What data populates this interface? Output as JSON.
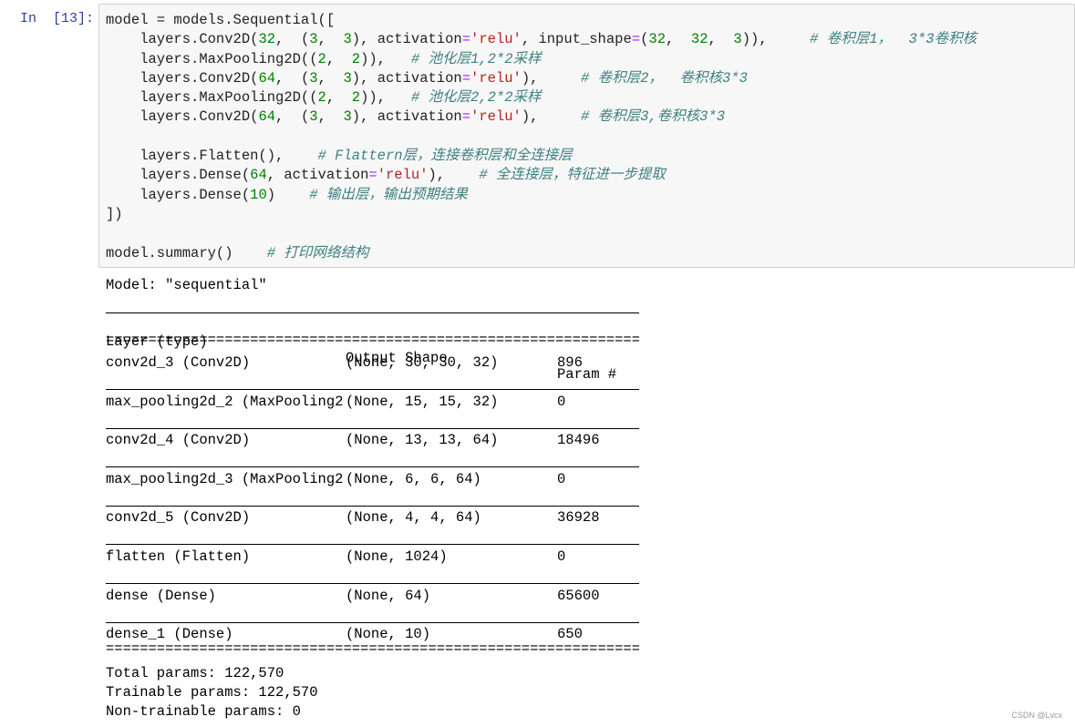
{
  "cell": {
    "prompt": "In  [13]:"
  },
  "code_lines": [
    [
      {
        "t": "model = models.Sequential([",
        "c": ""
      }
    ],
    [
      {
        "t": "    layers.Conv2D(",
        "c": ""
      },
      {
        "t": "32",
        "c": "n"
      },
      {
        "t": ",  (",
        "c": ""
      },
      {
        "t": "3",
        "c": "n"
      },
      {
        "t": ",  ",
        "c": ""
      },
      {
        "t": "3",
        "c": "n"
      },
      {
        "t": "), activation",
        "c": ""
      },
      {
        "t": "=",
        "c": "o"
      },
      {
        "t": "'relu'",
        "c": "s"
      },
      {
        "t": ", input_shape",
        "c": ""
      },
      {
        "t": "=",
        "c": "o"
      },
      {
        "t": "(",
        "c": ""
      },
      {
        "t": "32",
        "c": "n"
      },
      {
        "t": ",  ",
        "c": ""
      },
      {
        "t": "32",
        "c": "n"
      },
      {
        "t": ",  ",
        "c": ""
      },
      {
        "t": "3",
        "c": "n"
      },
      {
        "t": ")),     ",
        "c": ""
      },
      {
        "t": "# 卷积层1，  3*3卷积核",
        "c": "c"
      }
    ],
    [
      {
        "t": "    layers.MaxPooling2D((",
        "c": ""
      },
      {
        "t": "2",
        "c": "n"
      },
      {
        "t": ",  ",
        "c": ""
      },
      {
        "t": "2",
        "c": "n"
      },
      {
        "t": ")),   ",
        "c": ""
      },
      {
        "t": "# 池化层1,2*2采样",
        "c": "c"
      }
    ],
    [
      {
        "t": "    layers.Conv2D(",
        "c": ""
      },
      {
        "t": "64",
        "c": "n"
      },
      {
        "t": ",  (",
        "c": ""
      },
      {
        "t": "3",
        "c": "n"
      },
      {
        "t": ",  ",
        "c": ""
      },
      {
        "t": "3",
        "c": "n"
      },
      {
        "t": "), activation",
        "c": ""
      },
      {
        "t": "=",
        "c": "o"
      },
      {
        "t": "'relu'",
        "c": "s"
      },
      {
        "t": "),     ",
        "c": ""
      },
      {
        "t": "# 卷积层2，  卷积核3*3",
        "c": "c"
      }
    ],
    [
      {
        "t": "    layers.MaxPooling2D((",
        "c": ""
      },
      {
        "t": "2",
        "c": "n"
      },
      {
        "t": ",  ",
        "c": ""
      },
      {
        "t": "2",
        "c": "n"
      },
      {
        "t": ")),   ",
        "c": ""
      },
      {
        "t": "# 池化层2,2*2采样",
        "c": "c"
      }
    ],
    [
      {
        "t": "    layers.Conv2D(",
        "c": ""
      },
      {
        "t": "64",
        "c": "n"
      },
      {
        "t": ",  (",
        "c": ""
      },
      {
        "t": "3",
        "c": "n"
      },
      {
        "t": ",  ",
        "c": ""
      },
      {
        "t": "3",
        "c": "n"
      },
      {
        "t": "), activation",
        "c": ""
      },
      {
        "t": "=",
        "c": "o"
      },
      {
        "t": "'relu'",
        "c": "s"
      },
      {
        "t": "),     ",
        "c": ""
      },
      {
        "t": "# 卷积层3,卷积核3*3",
        "c": "c"
      }
    ],
    [
      {
        "t": "",
        "c": ""
      }
    ],
    [
      {
        "t": "    layers.Flatten(),    ",
        "c": ""
      },
      {
        "t": "# Flattern层，连接卷积层和全连接层",
        "c": "c"
      }
    ],
    [
      {
        "t": "    layers.Dense(",
        "c": ""
      },
      {
        "t": "64",
        "c": "n"
      },
      {
        "t": ", activation",
        "c": ""
      },
      {
        "t": "=",
        "c": "o"
      },
      {
        "t": "'relu'",
        "c": "s"
      },
      {
        "t": "),    ",
        "c": ""
      },
      {
        "t": "# 全连接层，特征进一步提取",
        "c": "c"
      }
    ],
    [
      {
        "t": "    layers.Dense(",
        "c": ""
      },
      {
        "t": "10",
        "c": "n"
      },
      {
        "t": ")    ",
        "c": ""
      },
      {
        "t": "# 输出层，输出预期结果",
        "c": "c"
      }
    ],
    [
      {
        "t": "])",
        "c": ""
      }
    ],
    [
      {
        "t": "",
        "c": ""
      }
    ],
    [
      {
        "t": "model.summary()    ",
        "c": ""
      },
      {
        "t": "# 打印网络结构",
        "c": "c"
      }
    ]
  ],
  "output": {
    "model_line": "Model: \"sequential\"",
    "headers": {
      "layer": "Layer (type)",
      "shape": "Output Shape",
      "param": "Param #"
    },
    "eq_rule": "=================================================================",
    "rows": [
      {
        "layer": "conv2d_3 (Conv2D)",
        "shape": "(None, 30, 30, 32)",
        "param": "896"
      },
      {
        "layer": "max_pooling2d_2 (MaxPooling2",
        "shape": "(None, 15, 15, 32)",
        "param": "0"
      },
      {
        "layer": "conv2d_4 (Conv2D)",
        "shape": "(None, 13, 13, 64)",
        "param": "18496"
      },
      {
        "layer": "max_pooling2d_3 (MaxPooling2",
        "shape": "(None, 6, 6, 64)",
        "param": "0"
      },
      {
        "layer": "conv2d_5 (Conv2D)",
        "shape": "(None, 4, 4, 64)",
        "param": "36928"
      },
      {
        "layer": "flatten (Flatten)",
        "shape": "(None, 1024)",
        "param": "0"
      },
      {
        "layer": "dense (Dense)",
        "shape": "(None, 64)",
        "param": "65600"
      },
      {
        "layer": "dense_1 (Dense)",
        "shape": "(None, 10)",
        "param": "650"
      }
    ],
    "total_params": "Total params: 122,570",
    "trainable_params": "Trainable params: 122,570",
    "non_trainable_params": "Non-trainable params: 0"
  },
  "watermark": "CSDN @Lvcx"
}
